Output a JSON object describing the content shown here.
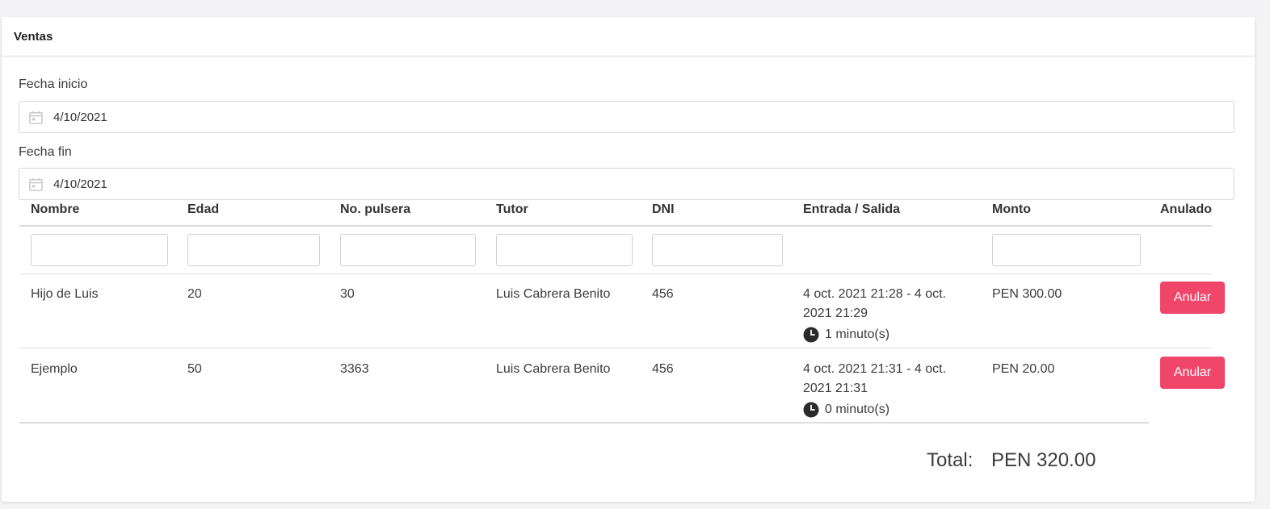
{
  "header": {
    "title": "Ventas"
  },
  "filters": {
    "start_label": "Fecha inicio",
    "start_value": "4/10/2021",
    "end_label": "Fecha fin",
    "end_value": "4/10/2021"
  },
  "table": {
    "columns": [
      "Nombre",
      "Edad",
      "No. pulsera",
      "Tutor",
      "DNI",
      "Entrada / Salida",
      "Monto",
      "Anulado"
    ],
    "rows": [
      {
        "nombre": "Hijo de Luis",
        "edad": "20",
        "pulsera": "30",
        "tutor": "Luis Cabrera Benito",
        "dni": "456",
        "entrada_salida_line1": "4 oct. 2021 21:28 - 4 oct.",
        "entrada_salida_line2": "2021 21:29",
        "duracion": "1 minuto(s)",
        "monto": "PEN 300.00",
        "action": "Anular"
      },
      {
        "nombre": "Ejemplo",
        "edad": "50",
        "pulsera": "3363",
        "tutor": "Luis Cabrera Benito",
        "dni": "456",
        "entrada_salida_line1": "4 oct. 2021 21:31 - 4 oct.",
        "entrada_salida_line2": "2021 21:31",
        "duracion": "0 minuto(s)",
        "monto": "PEN 20.00",
        "action": "Anular"
      }
    ]
  },
  "summary": {
    "total_label": "Total:",
    "total_value": "PEN 320.00"
  },
  "colors": {
    "accent": "#f0466a",
    "border": "#dcdce0"
  },
  "icons": {
    "date": "calendar-icon",
    "duration": "clock-icon"
  }
}
